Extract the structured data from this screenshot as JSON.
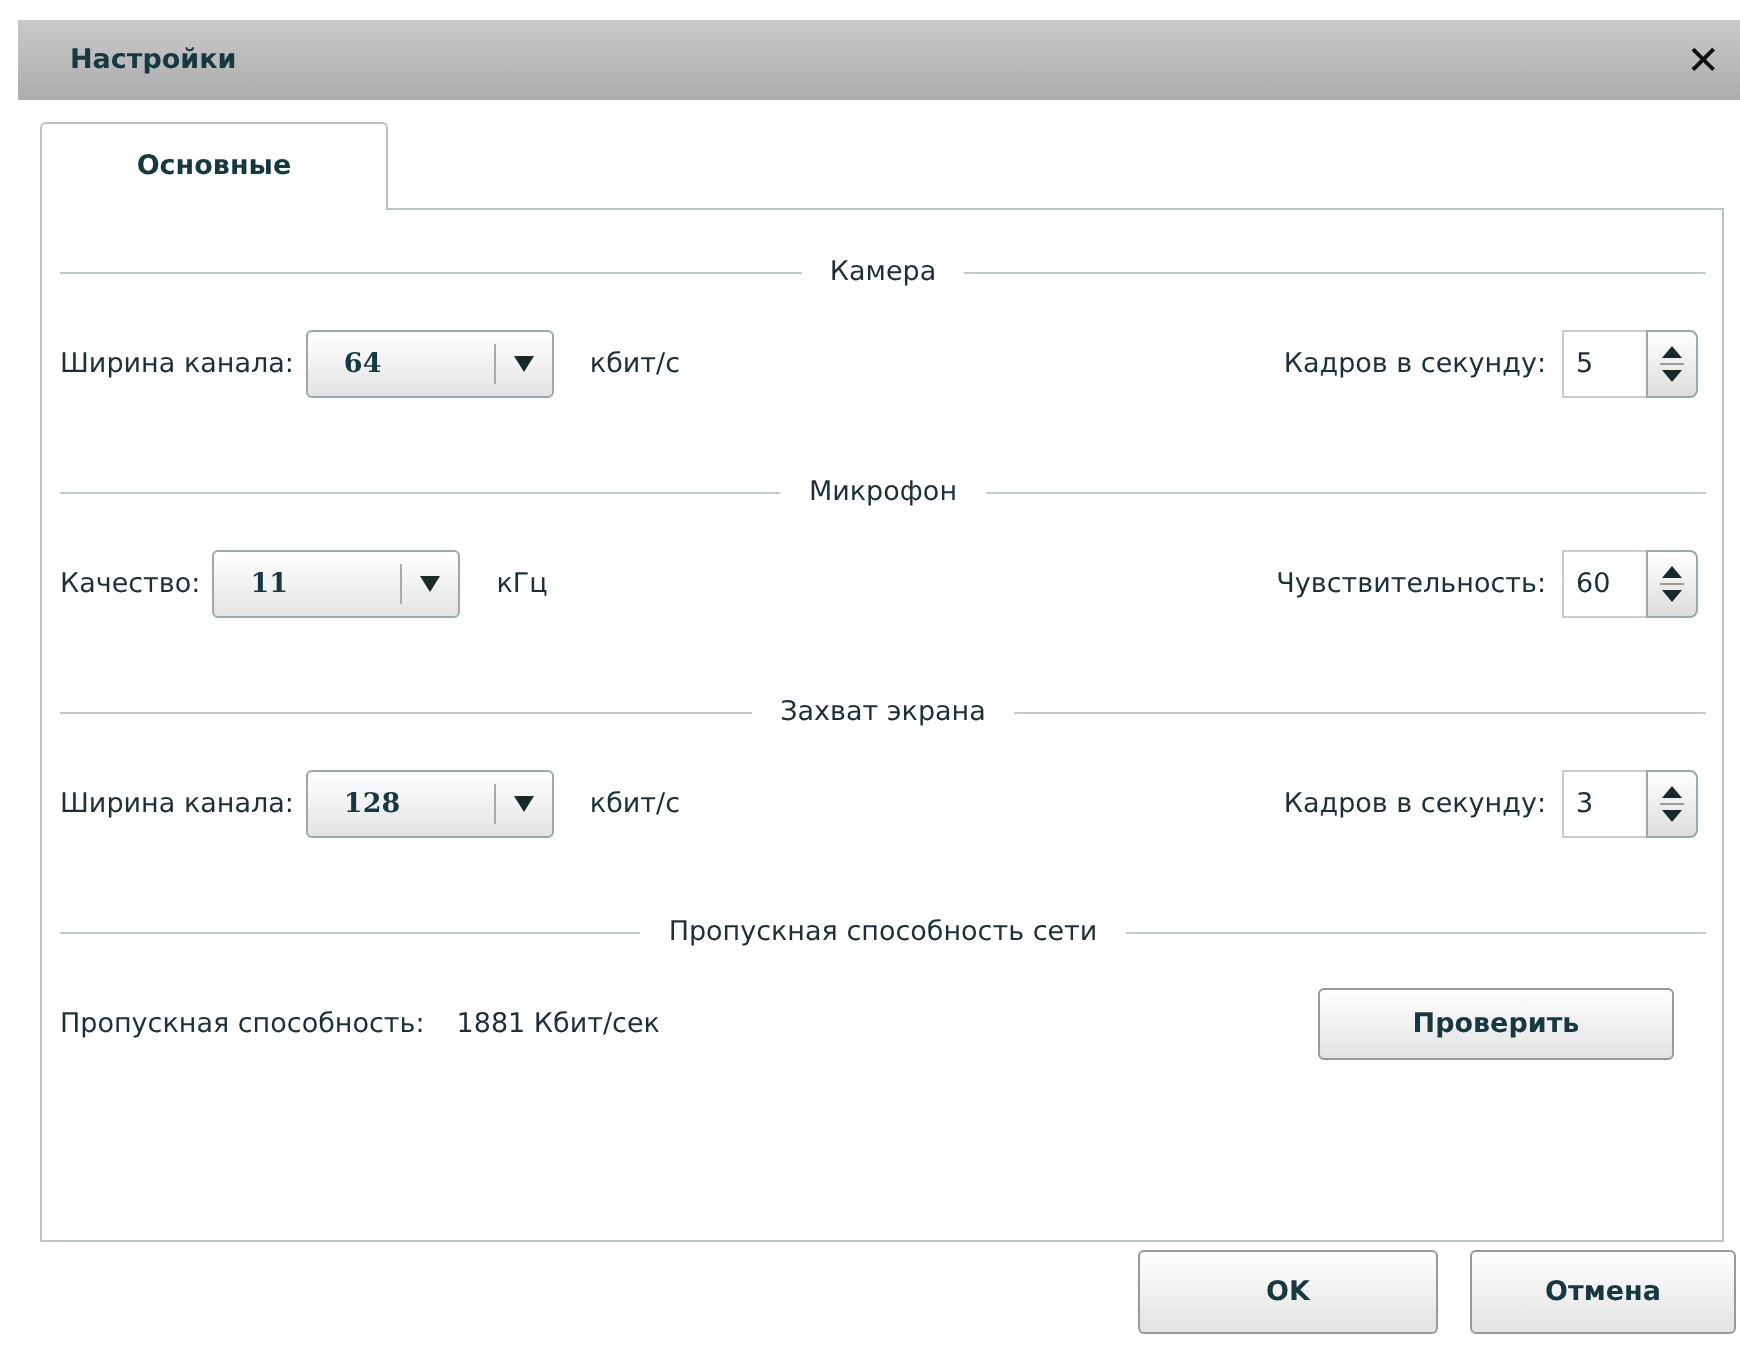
{
  "window": {
    "title": "Настройки",
    "close": "✕"
  },
  "tabs": [
    {
      "label": "Основные",
      "selected": true
    }
  ],
  "sections": [
    {
      "kind": "settings",
      "title": "Камера",
      "select": {
        "label": "Ширина канала:",
        "value": "64",
        "unit": "кбит/с"
      },
      "spinner": {
        "label": "Кадров в секунду:",
        "value": "5"
      }
    },
    {
      "kind": "settings",
      "title": "Микрофон",
      "select": {
        "label": "Качество:",
        "value": "11",
        "unit": "кГц"
      },
      "spinner": {
        "label": "Чувствительность:",
        "value": "60"
      }
    },
    {
      "kind": "settings",
      "title": "Захват экрана",
      "select": {
        "label": "Ширина канала:",
        "value": "128",
        "unit": "кбит/с"
      },
      "spinner": {
        "label": "Кадров в секунду:",
        "value": "3"
      }
    },
    {
      "kind": "network",
      "title": "Пропускная способность сети",
      "label": "Пропускная способность:",
      "value": "1881 Кбит/сек",
      "button": "Проверить"
    }
  ],
  "buttons": [
    "OK",
    "Отмена"
  ]
}
